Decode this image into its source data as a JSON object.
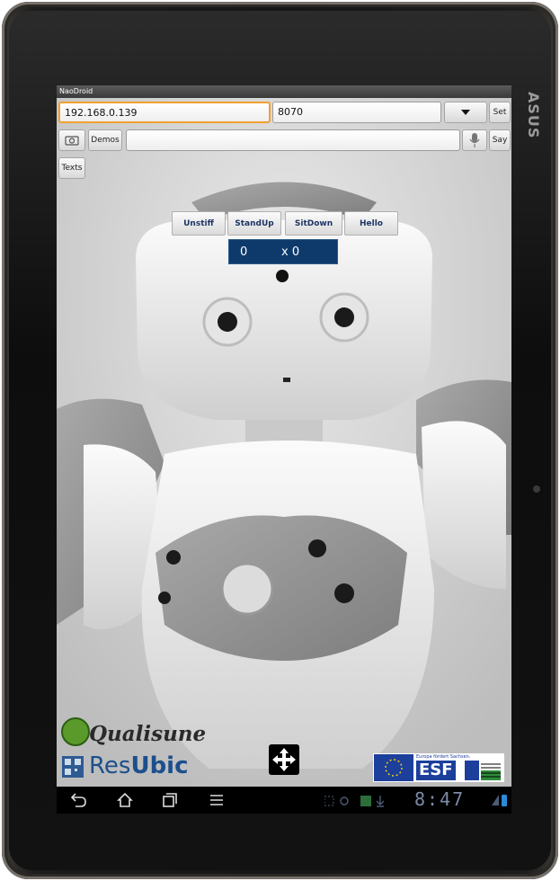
{
  "app": {
    "title": "NaoDroid"
  },
  "connection": {
    "ip_value": "192.168.0.139",
    "port_value": "8070",
    "set_label": "Set"
  },
  "speech": {
    "demos_label": "Demos",
    "say_value": "",
    "say_label": "Say",
    "texts_label": "Texts"
  },
  "actions": {
    "unstiff": "Unstiff",
    "standup": "StandUp",
    "sitdown": "SitDown",
    "hello": "Hello"
  },
  "counter": {
    "left": "0",
    "right": "x 0"
  },
  "logos": {
    "qualisune": "Qualisune",
    "resubic_res": "Res",
    "resubic_ubic": "Ubic",
    "esf_text": "ESF",
    "esf_tagline": "Europa fördert Sachsen."
  },
  "status": {
    "time": "8:47"
  },
  "icons": {
    "camera": "camera-icon",
    "mic": "microphone-icon",
    "dropdown": "dropdown-arrow-icon",
    "move": "move-arrows-icon",
    "back": "back-icon",
    "home": "home-icon",
    "recent": "recent-apps-icon",
    "menu": "menu-icon"
  }
}
